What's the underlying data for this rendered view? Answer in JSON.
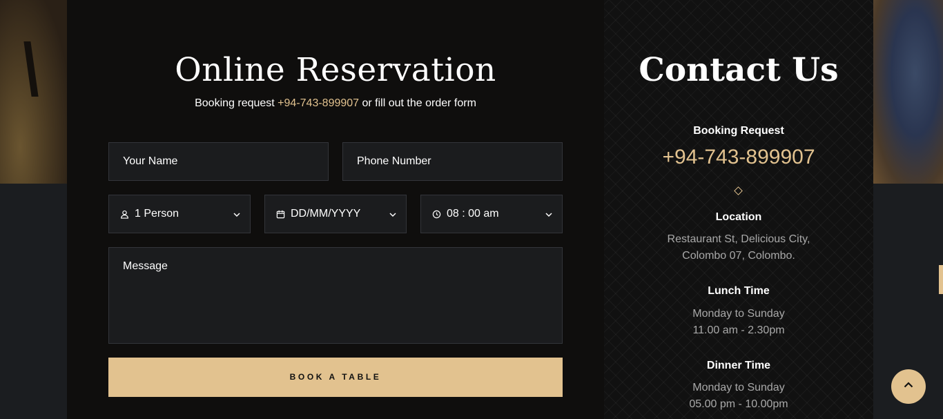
{
  "reservation": {
    "title": "Online Reservation",
    "subtitle_prefix": "Booking request ",
    "subtitle_phone": "+94-743-899907",
    "subtitle_suffix": " or fill out the order form",
    "fields": {
      "name_placeholder": "Your Name",
      "phone_placeholder": "Phone Number",
      "person_value": "1 Person",
      "date_value": "DD/MM/YYYY",
      "time_value": "08 : 00 am",
      "message_placeholder": "Message"
    },
    "button_label": "BOOK A TABLE"
  },
  "contact": {
    "title": "Contact Us",
    "booking_label": "Booking Request",
    "booking_phone": "+94-743-899907",
    "location_label": "Location",
    "location_line1": "Restaurant St, Delicious City,",
    "location_line2": "Colombo 07, Colombo.",
    "lunch_label": "Lunch Time",
    "lunch_days": "Monday to Sunday",
    "lunch_hours": "11.00 am - 2.30pm",
    "dinner_label": "Dinner Time",
    "dinner_days": "Monday to Sunday",
    "dinner_hours": "05.00 pm - 10.00pm"
  },
  "colors": {
    "accent": "#e2c28f",
    "panel": "#0f0e0d",
    "field_bg": "#1b1c1e"
  },
  "icons": [
    "user-icon",
    "calendar-icon",
    "clock-icon",
    "chevron-down-icon",
    "chevron-up-icon",
    "diamond-icon"
  ]
}
